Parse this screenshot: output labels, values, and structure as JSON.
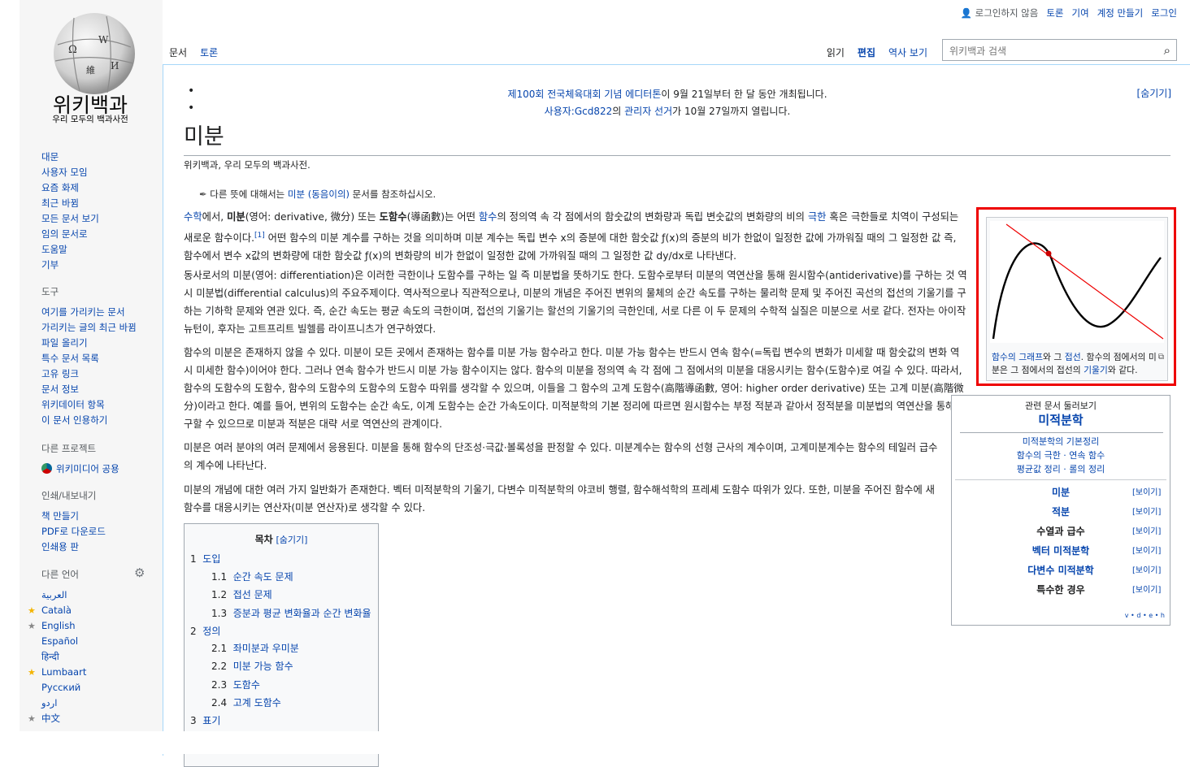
{
  "personal": {
    "not_logged_in": "로그인하지 않음",
    "talk": "토론",
    "contrib": "기여",
    "create_account": "계정 만들기",
    "login": "로그인"
  },
  "logo": {
    "wordmark": "위키백과",
    "tagline": "우리 모두의 백과사전"
  },
  "tabs": {
    "article": "문서",
    "talk": "토론",
    "read": "읽기",
    "edit": "편집",
    "history": "역사 보기"
  },
  "search": {
    "placeholder": "위키백과 검색",
    "icon": "search-icon"
  },
  "sidebar": {
    "nav": [
      "대문",
      "사용자 모임",
      "요즘 화제",
      "최근 바뀜",
      "모든 문서 보기",
      "임의 문서로",
      "도움말",
      "기부"
    ],
    "tools_heading": "도구",
    "tools": [
      "여기를 가리키는 문서",
      "가리키는 글의 최근 바뀜",
      "파일 올리기",
      "특수 문서 목록",
      "고유 링크",
      "문서 정보",
      "위키데이터 항목",
      "이 문서 인용하기"
    ],
    "projects_heading": "다른 프로젝트",
    "commons": "위키미디어 공용",
    "print_heading": "인쇄/내보내기",
    "print": [
      "책 만들기",
      "PDF로 다운로드",
      "인쇄용 판"
    ],
    "lang_heading": "다른 언어",
    "languages": [
      "العربية",
      "Català",
      "English",
      "Español",
      "हिन्दी",
      "Lumbaart",
      "Русский",
      "اردو",
      "中文"
    ]
  },
  "notice": {
    "line1_link": "제100회 전국체육대회 기념 에디터톤",
    "line1_rest": "이 9월 21일부터 한 달 동안 개최됩니다.",
    "line2_link1": "사용자:Gcd822",
    "line2_mid": "의 ",
    "line2_link2": "관리자 선거",
    "line2_rest": "가 10월 27일까지 열립니다.",
    "hide": "[숨기기]"
  },
  "article": {
    "title": "미분",
    "tagline": "위키백과, 우리 모두의 백과사전.",
    "hatnote_pre": "다른 뜻에 대해서는 ",
    "hatnote_link": "미분 (동음이의)",
    "hatnote_post": " 문서를 참조하십시오.",
    "p1a": "수학",
    "p1b": "에서, ",
    "p1c": "미분",
    "p1d": "(영어: derivative, 微分) 또는 ",
    "p1e": "도함수",
    "p1f": "(導函數)는 어떤 ",
    "p1g": "함수",
    "p1h": "의 정의역 속 각 점에서의 함숫값의 변화량과 독립 변숫값의 변화량의 비의 ",
    "p1i": "극한",
    "p1j": " 혹은 극한들로 치역이 구성되는 새로운 함수이다.",
    "p1k": "[1]",
    "p1l": " 어떤 함수의 미분 계수를 구하는 것을 의미하며 미분 계수는 독립 변수 x의 증분에 대한 함숫값 ƒ(x)의 증분의 비가 한없이 일정한 값에 가까워질 때의 그 일정한 값 즉, 함수에서 변수 x값의 변화량에 대한 함숫값 ƒ(x)의 변화량의 비가 한없이 일정한 값에 가까워질 때의 그 일정한 값 dy/dx로 나타낸다.",
    "p2": "동사로서의 미분(영어: differentiation)은 이러한 극한이나 도함수를 구하는 일 즉 미분법을 뜻하기도 한다. 도함수로부터 미분의 역연산을 통해 원시함수(antiderivative)를 구하는 것 역시 미분법(differential calculus)의 주요주제이다. 역사적으로나 직관적으로나, 미분의 개념은 주어진 변위의 물체의 순간 속도를 구하는 물리학 문제 및 주어진 곡선의 접선의 기울기를 구하는 기하학 문제와 연관 있다. 즉, 순간 속도는 평균 속도의 극한이며, 접선의 기울기는 할선의 기울기의 극한인데, 서로 다른 이 두 문제의 수학적 실질은 미분으로 서로 같다. 전자는 아이작 뉴턴이, 후자는 고트프리트 빌헬름 라이프니츠가 연구하였다.",
    "p3": "함수의 미분은 존재하지 않을 수 있다. 미분이 모든 곳에서 존재하는 함수를 미분 가능 함수라고 한다. 미분 가능 함수는 반드시 연속 함수(=독립 변수의 변화가 미세할 때 함숫값의 변화 역시 미세한 함수)이어야 한다. 그러나 연속 함수가 반드시 미분 가능 함수이지는 않다. 함수의 미분을 정의역 속 각 점에 그 점에서의 미분을 대응시키는 함수(도함수)로 여길 수 있다. 따라서, 함수의 도함수의 도함수, 함수의 도함수의 도함수의 도함수 따위를 생각할 수 있으며, 이들을 그 함수의 고계 도함수(高階導函數, 영어: higher order derivative) 또는 고계 미분(高階微分)이라고 한다. 예를 들어, 변위의 도함수는 순간 속도, 이계 도함수는 순간 가속도이다. 미적분학의 기본 정리에 따르면 원시함수는 부정 적분과 같아서 정적분을 미분법의 역연산을 통해 구할 수 있으므로 미분과 적분은 대략 서로 역연산의 관계이다.",
    "p4": "미분은 여러 분야의 여러 문제에서 응용된다. 미분을 통해 함수의 단조성·극값·볼록성을 판정할 수 있다. 미분계수는 함수의 선형 근사의 계수이며, 고계미분계수는 함수의 테일러 급수의 계수에 나타난다.",
    "p5": "미분의 개념에 대한 여러 가지 일반화가 존재한다. 벡터 미적분학의 기울기, 다변수 미적분학의 야코비 행렬, 함수해석학의 프레셰 도함수 따위가 있다. 또한, 미분을 주어진 함수에 새 함수를 대응시키는 연산자(미분 연산자)로 생각할 수 있다."
  },
  "thumb": {
    "cap1": "함수의 그래프",
    "cap2": "와 그 ",
    "cap3": "접선",
    "cap4": ". 함수의 점에서의 미분은 그 점에서의 접선의 ",
    "cap5": "기울기",
    "cap6": "와 같다."
  },
  "navbox": {
    "above": "관련 문서 둘러보기",
    "title": "미적분학",
    "line1": "미적분학의 기본정리",
    "line2": "함수의 극한 · 연속 함수",
    "line3": "평균값 정리 · 롤의 정리",
    "rows": [
      {
        "label": "미분",
        "link": true
      },
      {
        "label": "적분",
        "link": true
      },
      {
        "label": "수열과 급수",
        "link": false
      },
      {
        "label": "벡터 미적분학",
        "link": true
      },
      {
        "label": "다변수 미적분학",
        "link": true
      },
      {
        "label": "특수한 경우",
        "link": false
      }
    ],
    "show": "[보이기]",
    "vde": "v • d • e • h"
  },
  "toc": {
    "title": "목차",
    "hide": "[숨기기]",
    "items": [
      {
        "num": "1",
        "text": "도입",
        "level": 1
      },
      {
        "num": "1.1",
        "text": "순간 속도 문제",
        "level": 2
      },
      {
        "num": "1.2",
        "text": "접선 문제",
        "level": 2
      },
      {
        "num": "1.3",
        "text": "증분과 평균 변화율과 순간 변화율",
        "level": 2
      },
      {
        "num": "2",
        "text": "정의",
        "level": 1
      },
      {
        "num": "2.1",
        "text": "좌미분과 우미분",
        "level": 2
      },
      {
        "num": "2.2",
        "text": "미분 가능 함수",
        "level": 2
      },
      {
        "num": "2.3",
        "text": "도함수",
        "level": 2
      },
      {
        "num": "2.4",
        "text": "고계 도함수",
        "level": 2
      },
      {
        "num": "3",
        "text": "표기",
        "level": 1
      }
    ]
  }
}
